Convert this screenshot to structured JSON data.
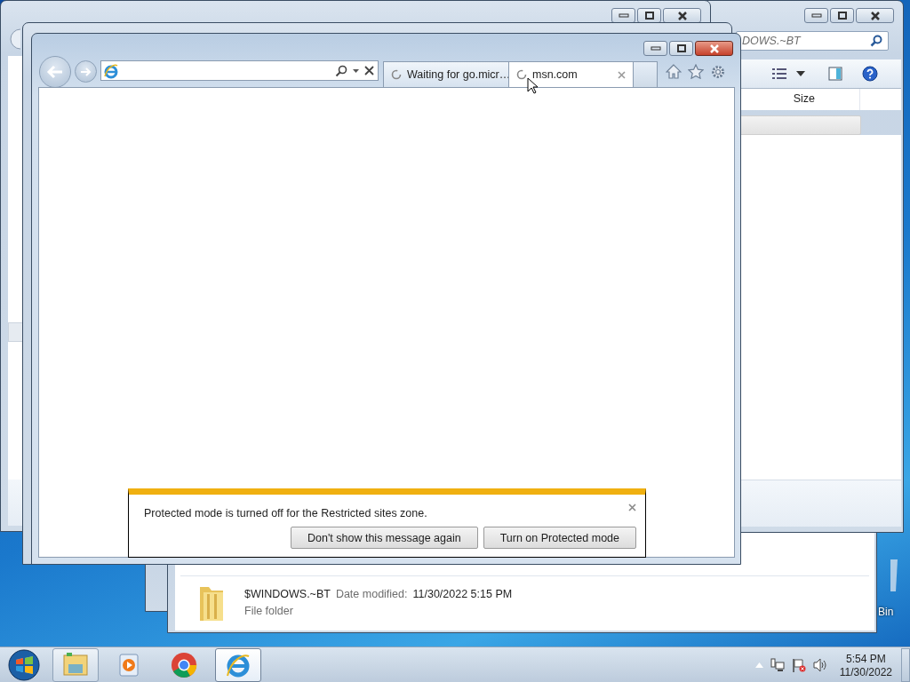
{
  "background_explorer": {
    "search": {
      "placeholder": "DOWS.~BT"
    },
    "columns": [
      "Size"
    ]
  },
  "browser": {
    "tabs": [
      {
        "label": "Waiting for go.micr…",
        "selected": false,
        "loading": true
      },
      {
        "label": "msn.com",
        "selected": true,
        "loading": true
      }
    ],
    "notification": {
      "message": "Protected mode is turned off for the Restricted sites zone.",
      "buttons": [
        "Don't show this message again",
        "Turn on Protected mode"
      ]
    }
  },
  "folder_window": {
    "items": [
      {
        "name": "$WINDOWS.~BT",
        "meta_label": "Date modified:",
        "meta_value": "11/30/2022 5:15 PM",
        "type": "File folder"
      }
    ]
  },
  "desktop_icons": [
    {
      "label": "Bin"
    }
  ],
  "taskbar": {
    "items": [
      {
        "kind": "explorer",
        "running": true,
        "active": false
      },
      {
        "kind": "media",
        "running": false,
        "active": false
      },
      {
        "kind": "chrome",
        "running": false,
        "active": false
      },
      {
        "kind": "ie",
        "running": true,
        "active": true
      }
    ],
    "clock": {
      "time": "5:54 PM",
      "date": "11/30/2022"
    }
  }
}
